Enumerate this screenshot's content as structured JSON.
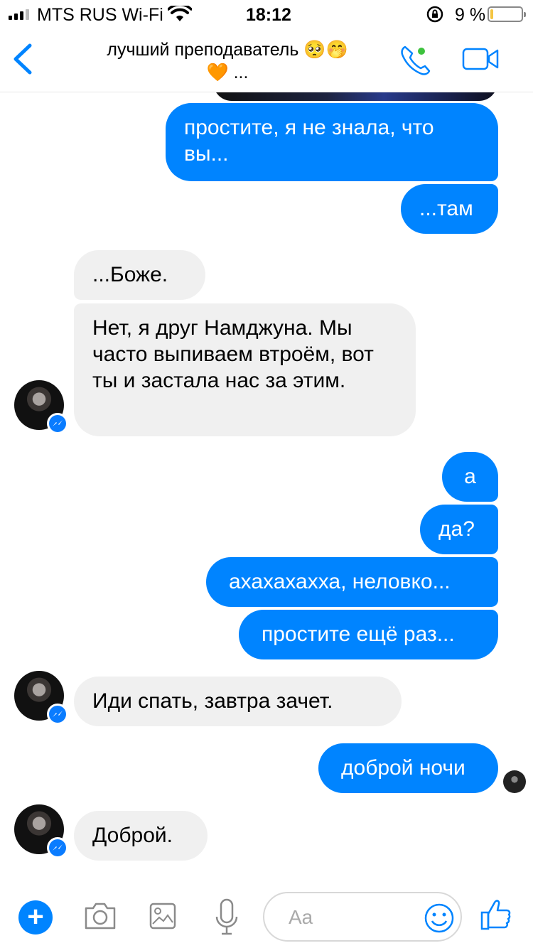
{
  "status": {
    "carrier": "MTS RUS Wi-Fi",
    "time": "18:12",
    "battery": "9 %",
    "battery_level": 0.09,
    "battery_color": "#f4c542"
  },
  "header": {
    "title_line1": "лучший преподаватель 🥺🤭",
    "title_line2": "🧡 ...",
    "back_icon": "chevron-left-icon",
    "call_icon": "phone-icon",
    "video_icon": "video-camera-icon",
    "online_color": "#3ec23e"
  },
  "colors": {
    "outgoing": "#0084ff",
    "incoming": "#f0f0f0",
    "accent": "#0084ff"
  },
  "messages": [
    {
      "side": "out",
      "text": "простите, я не знала, что вы..."
    },
    {
      "side": "out",
      "text": "...там"
    },
    {
      "side": "in",
      "text": "...Боже."
    },
    {
      "side": "in",
      "text": "Нет, я друг Намджуна. Мы часто выпиваем втроём, вот ты и застала нас за этим."
    },
    {
      "side": "out",
      "text": "а"
    },
    {
      "side": "out",
      "text": "да?"
    },
    {
      "side": "out",
      "text": "ахахахахха, неловко..."
    },
    {
      "side": "out",
      "text": "простите ещё раз..."
    },
    {
      "side": "in",
      "text": "Иди спать, завтра зачет."
    },
    {
      "side": "out",
      "text": "доброй ночи"
    },
    {
      "side": "in",
      "text": "Доброй."
    }
  ],
  "composer": {
    "placeholder": "Aa",
    "icons": [
      "plus-icon",
      "camera-icon",
      "photo-icon",
      "microphone-icon",
      "emoji-icon",
      "thumbs-up-icon"
    ]
  }
}
